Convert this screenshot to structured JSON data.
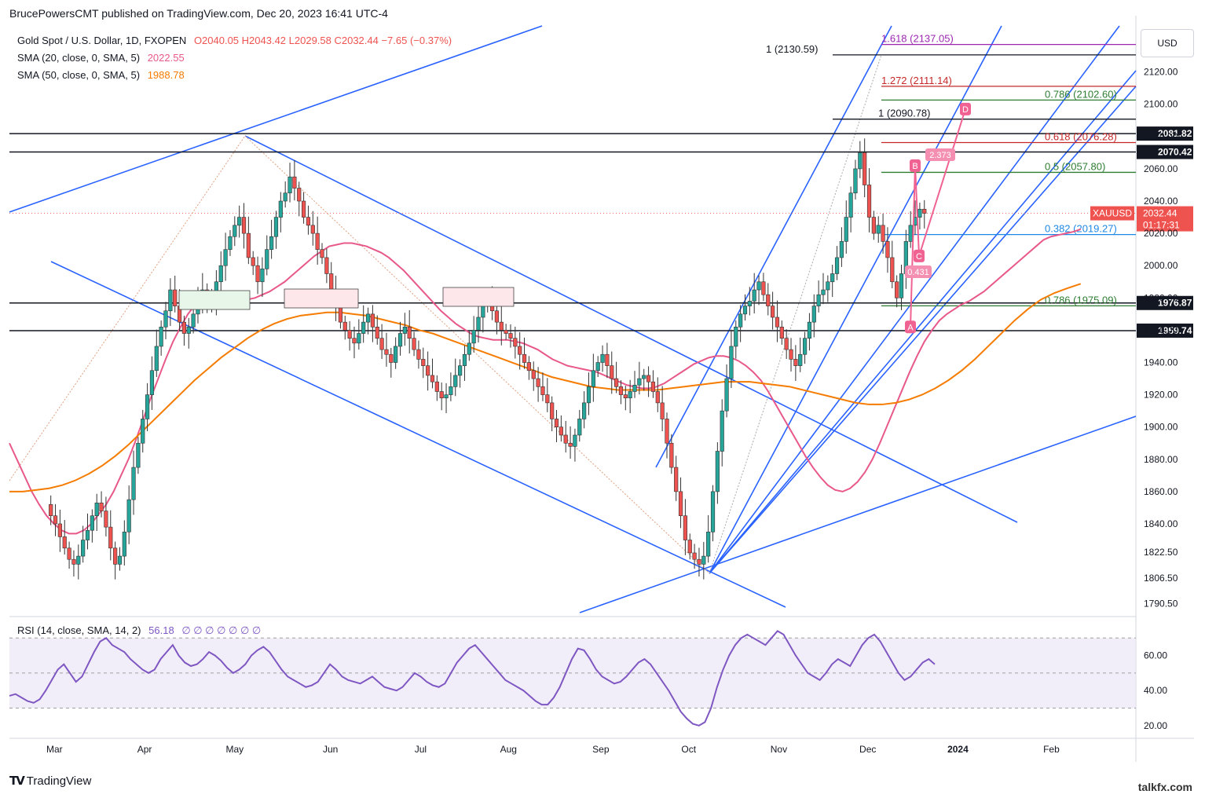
{
  "publisher": "BrucePowersCMT published on TradingView.com, Dec 20, 2023 16:41 UTC-4",
  "legend": {
    "symbol": "Gold Spot / U.S. Dollar, 1D, FXOPEN",
    "ohlc": "O2040.05  H2043.42  L2029.58  C2032.44  −7.65 (−0.37%)",
    "sma20_label": "SMA (20, close, 0, SMA, 5)",
    "sma20_value": "2022.55",
    "sma50_label": "SMA (50, close, 0, SMA, 5)",
    "sma50_value": "1988.78",
    "rsi_label": "RSI (14, close, SMA, 14, 2)",
    "rsi_value": "56.18",
    "rsi_dots": "∅ ∅ ∅ ∅ ∅ ∅ ∅"
  },
  "currency_button": "USD",
  "branding": {
    "logo": "TradingView",
    "watermark": "talkfx.com"
  },
  "colors": {
    "up": "#26a69a",
    "down": "#ef5350",
    "sma20": "#e8588a",
    "sma50": "#f57c00",
    "trend": "#2962ff",
    "rsi": "#7e57c2"
  },
  "chart_data": [
    {
      "type": "candlestick",
      "symbol": "XAUUSD",
      "interval": "1D",
      "ylim": [
        1785,
        2150
      ],
      "y_ticks": [
        "2120.00",
        "2100.00",
        "2080.00",
        "2060.00",
        "2040.00",
        "2020.00",
        "2000.00",
        "1980.00",
        "1960.00",
        "1940.00",
        "1920.00",
        "1900.00",
        "1880.00",
        "1860.00",
        "1840.00",
        "1822.50",
        "1806.50",
        "1790.50"
      ],
      "x_labels": [
        "Mar",
        "Apr",
        "May",
        "Jun",
        "Jul",
        "Aug",
        "Sep",
        "Oct",
        "Nov",
        "Dec",
        "2024",
        "Feb"
      ],
      "last_price_label": "XAUUSD",
      "last_price": "2032.44",
      "countdown": "01:17:31",
      "horizontal_levels": [
        {
          "label": "2081.82",
          "value": 2081.82
        },
        {
          "label": "2070.42",
          "value": 2070.42
        },
        {
          "label": "1976.87",
          "value": 1976.87
        },
        {
          "label": "1959.74",
          "value": 1959.74
        }
      ],
      "fib_levels": [
        {
          "text": "1.618 (2137.05)",
          "value": 2137.05,
          "color": "#9c27b0"
        },
        {
          "text": "1 (2130.59)",
          "value": 2130.59,
          "color": "#131722"
        },
        {
          "text": "1.272 (2111.14)",
          "value": 2111.14,
          "color": "#c62828"
        },
        {
          "text": "0.786 (2102.60)",
          "value": 2102.6,
          "color": "#2e7d32"
        },
        {
          "text": "1 (2090.78)",
          "value": 2090.78,
          "color": "#131722"
        },
        {
          "text": "0.618 (2076.28)",
          "value": 2076.28,
          "color": "#c62828"
        },
        {
          "text": "0.5 (2057.80)",
          "value": 2057.8,
          "color": "#2e7d32"
        },
        {
          "text": "0.382 (2019.27)",
          "value": 2019.27,
          "color": "#1e88e5"
        },
        {
          "text": "0.786 (1975.09)",
          "value": 1975.09,
          "color": "#2e7d32"
        }
      ],
      "pattern_points": [
        {
          "label": "A",
          "value": 1962
        },
        {
          "label": "B",
          "value": 2062
        },
        {
          "label": "C",
          "value": 2006
        },
        {
          "label": "D",
          "value": 2097
        }
      ],
      "pattern_ratios": [
        "2.373",
        "0.431"
      ],
      "closes": [
        1852,
        1845,
        1840,
        1832,
        1825,
        1818,
        1815,
        1820,
        1830,
        1836,
        1845,
        1853,
        1848,
        1838,
        1825,
        1815,
        1820,
        1835,
        1855,
        1875,
        1890,
        1905,
        1920,
        1935,
        1950,
        1962,
        1972,
        1985,
        1975,
        1965,
        1958,
        1962,
        1970,
        1978,
        1985,
        1980,
        1975,
        1990,
        2000,
        2010,
        2018,
        2025,
        2030,
        2020,
        2005,
        2000,
        1990,
        1998,
        2010,
        2018,
        2030,
        2040,
        2045,
        2055,
        2048,
        2040,
        2030,
        2025,
        2020,
        2010,
        2005,
        1995,
        1985,
        1975,
        1965,
        1960,
        1955,
        1952,
        1958,
        1965,
        1970,
        1962,
        1955,
        1948,
        1945,
        1940,
        1950,
        1958,
        1962,
        1955,
        1948,
        1942,
        1938,
        1932,
        1928,
        1922,
        1918,
        1920,
        1925,
        1932,
        1938,
        1945,
        1952,
        1960,
        1968,
        1975,
        1980,
        1972,
        1965,
        1960,
        1958,
        1955,
        1950,
        1945,
        1940,
        1935,
        1930,
        1925,
        1920,
        1915,
        1905,
        1900,
        1895,
        1890,
        1888,
        1895,
        1905,
        1915,
        1925,
        1935,
        1940,
        1945,
        1938,
        1930,
        1925,
        1920,
        1918,
        1922,
        1926,
        1930,
        1932,
        1928,
        1922,
        1915,
        1905,
        1890,
        1875,
        1860,
        1845,
        1830,
        1822,
        1818,
        1815,
        1820,
        1835,
        1860,
        1885,
        1910,
        1930,
        1950,
        1962,
        1970,
        1975,
        1978,
        1985,
        1990,
        1982,
        1975,
        1968,
        1962,
        1955,
        1948,
        1942,
        1938,
        1945,
        1955,
        1965,
        1975,
        1982,
        1985,
        1990,
        1995,
        2005,
        2015,
        2030,
        2045,
        2060,
        2070,
        2050,
        2030,
        2020,
        2025,
        2015,
        2005,
        1990,
        1980,
        1995,
        2015,
        2025,
        2030,
        2035,
        2032.44
      ],
      "sma20": [
        1890,
        1880,
        1870,
        1860,
        1852,
        1845,
        1840,
        1836,
        1834,
        1834,
        1836,
        1840,
        1846,
        1852,
        1860,
        1870,
        1880,
        1892,
        1905,
        1918,
        1930,
        1942,
        1953,
        1962,
        1970,
        1976,
        1980,
        1982,
        1983,
        1982,
        1980,
        1979,
        1979,
        1980,
        1982,
        1984,
        1987,
        1990,
        1994,
        1998,
        2002,
        2006,
        2009,
        2012,
        2013,
        2014,
        2014,
        2013,
        2012,
        2010,
        2008,
        2005,
        2001,
        1997,
        1992,
        1987,
        1982,
        1977,
        1972,
        1968,
        1964,
        1961,
        1958,
        1956,
        1955,
        1954,
        1954,
        1954,
        1953,
        1952,
        1950,
        1948,
        1945,
        1942,
        1940,
        1938,
        1937,
        1936,
        1935,
        1934,
        1932,
        1930,
        1928,
        1926,
        1925,
        1924,
        1924,
        1925,
        1927,
        1930,
        1933,
        1936,
        1939,
        1941,
        1943,
        1944,
        1944,
        1943,
        1941,
        1938,
        1934,
        1929,
        1922,
        1914,
        1906,
        1898,
        1890,
        1882,
        1875,
        1869,
        1864,
        1861,
        1860,
        1862,
        1866,
        1872,
        1880,
        1890,
        1901,
        1912,
        1923,
        1934,
        1944,
        1953,
        1960,
        1966,
        1970,
        1973,
        1976,
        1978,
        1981,
        1984,
        1988,
        1992,
        1996,
        2000,
        2004,
        2008,
        2012,
        2016,
        2018,
        2019,
        2020,
        2021,
        2022.55
      ],
      "sma50": [
        1860,
        1860,
        1861,
        1862,
        1864,
        1867,
        1871,
        1876,
        1882,
        1889,
        1897,
        1905,
        1913,
        1921,
        1929,
        1936,
        1943,
        1949,
        1955,
        1960,
        1964,
        1967,
        1969,
        1970,
        1971,
        1971,
        1970,
        1969,
        1967,
        1965,
        1963,
        1960,
        1958,
        1955,
        1952,
        1949,
        1946,
        1943,
        1940,
        1937,
        1934,
        1931,
        1929,
        1927,
        1925,
        1924,
        1923,
        1923,
        1923,
        1923,
        1924,
        1925,
        1926,
        1927,
        1928,
        1928,
        1928,
        1927,
        1926,
        1925,
        1923,
        1921,
        1919,
        1917,
        1915,
        1914,
        1914,
        1915,
        1917,
        1920,
        1924,
        1929,
        1935,
        1942,
        1950,
        1958,
        1966,
        1973,
        1979,
        1983,
        1986,
        1988.78
      ],
      "rsi_data": {
        "ylim": [
          15,
          80
        ],
        "y_ticks": [
          "60.00",
          "40.00",
          "20.00"
        ],
        "bands": [
          70,
          50,
          30
        ],
        "values": [
          37,
          38,
          36,
          34,
          33,
          35,
          40,
          46,
          52,
          55,
          50,
          45,
          48,
          55,
          62,
          68,
          70,
          66,
          64,
          62,
          58,
          55,
          52,
          50,
          52,
          58,
          62,
          66,
          60,
          56,
          54,
          55,
          58,
          62,
          60,
          57,
          53,
          50,
          52,
          55,
          60,
          63,
          65,
          62,
          57,
          52,
          48,
          46,
          44,
          42,
          43,
          45,
          50,
          55,
          52,
          48,
          46,
          45,
          44,
          46,
          48,
          45,
          42,
          41,
          40,
          42,
          46,
          50,
          48,
          45,
          43,
          42,
          44,
          50,
          56,
          60,
          64,
          66,
          62,
          58,
          54,
          50,
          46,
          44,
          42,
          40,
          37,
          34,
          32,
          32,
          36,
          42,
          50,
          58,
          64,
          63,
          58,
          52,
          48,
          46,
          44,
          45,
          48,
          52,
          56,
          58,
          55,
          50,
          45,
          40,
          34,
          28,
          24,
          21,
          20,
          22,
          30,
          42,
          52,
          60,
          66,
          70,
          72,
          70,
          68,
          66,
          70,
          74,
          72,
          66,
          60,
          55,
          50,
          48,
          46,
          50,
          55,
          58,
          56,
          54,
          60,
          66,
          70,
          72,
          68,
          62,
          56,
          50,
          46,
          48,
          52,
          56,
          58,
          55
        ],
        "last": 56.18
      }
    }
  ]
}
